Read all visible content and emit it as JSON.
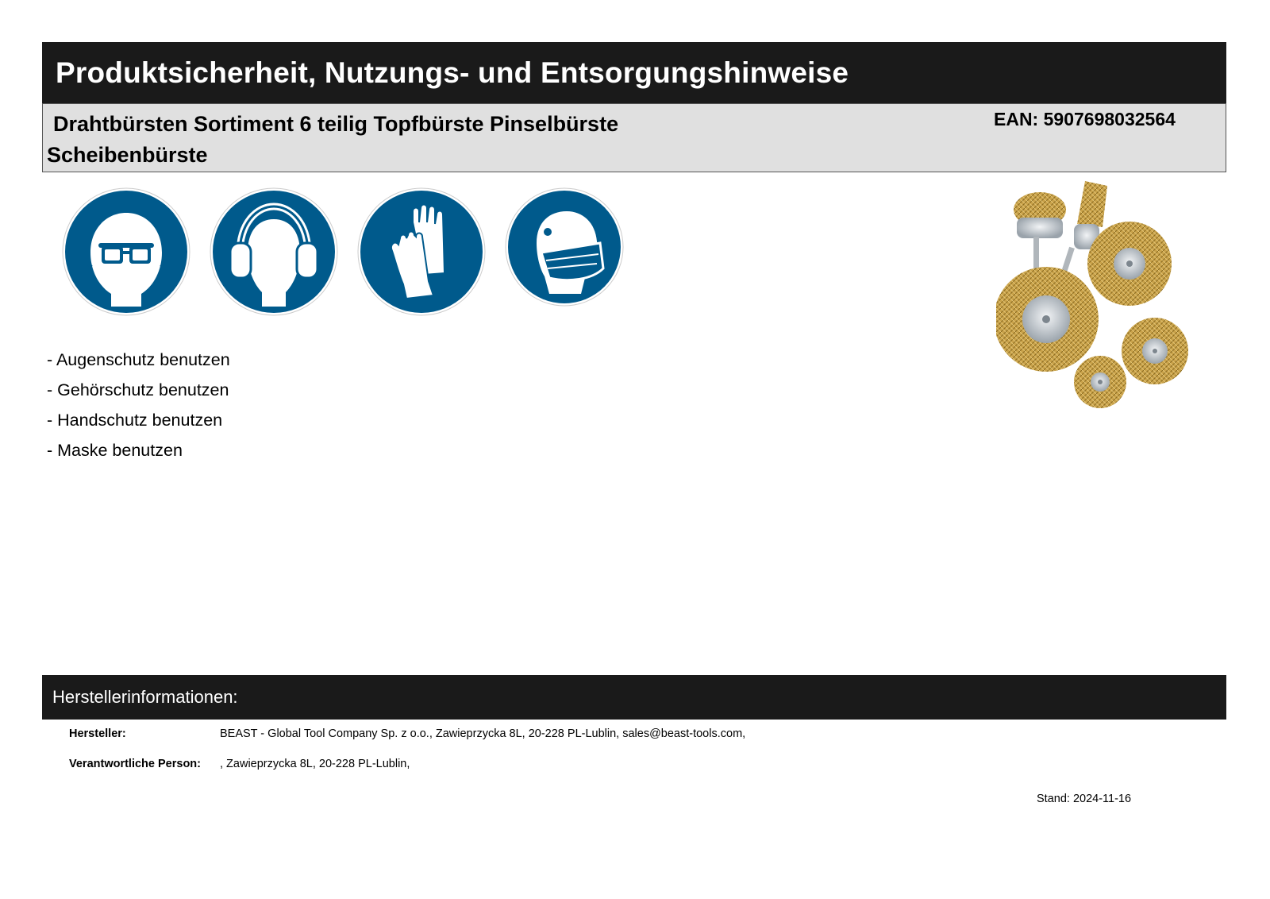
{
  "header": {
    "title": "Produktsicherheit, Nutzungs- und Entsorgungshinweise"
  },
  "product": {
    "name": "Drahtbürsten Sortiment 6 teilig Topfbürste Pinselbürste Scheibenbürste",
    "ean": "EAN: 5907698032564"
  },
  "safety_signs": [
    {
      "icon": "eye-protection-icon"
    },
    {
      "icon": "ear-protection-icon"
    },
    {
      "icon": "hand-protection-icon"
    },
    {
      "icon": "mask-icon"
    }
  ],
  "hints": [
    "- Augenschutz benutzen",
    "- Gehörschutz benutzen",
    "- Handschutz benutzen",
    "- Maske benutzen"
  ],
  "manufacturer_section": {
    "title": "Herstellerinformationen:",
    "rows": [
      {
        "label": "Hersteller:",
        "value": "BEAST - Global Tool Company Sp. z o.o., Zawieprzycka 8L, 20-228 PL-Lublin, sales@beast-tools.com,"
      },
      {
        "label": "Verantwortliche Person:",
        "value": ", Zawieprzycka 8L, 20-228 PL-Lublin,"
      }
    ]
  },
  "stand": "Stand: 2024-11-16",
  "colors": {
    "bar_dark": "#1a1a1a",
    "bar_light": "#e0e0e0",
    "sign_blue": "#005a8c",
    "brass": "#c9a24a"
  }
}
